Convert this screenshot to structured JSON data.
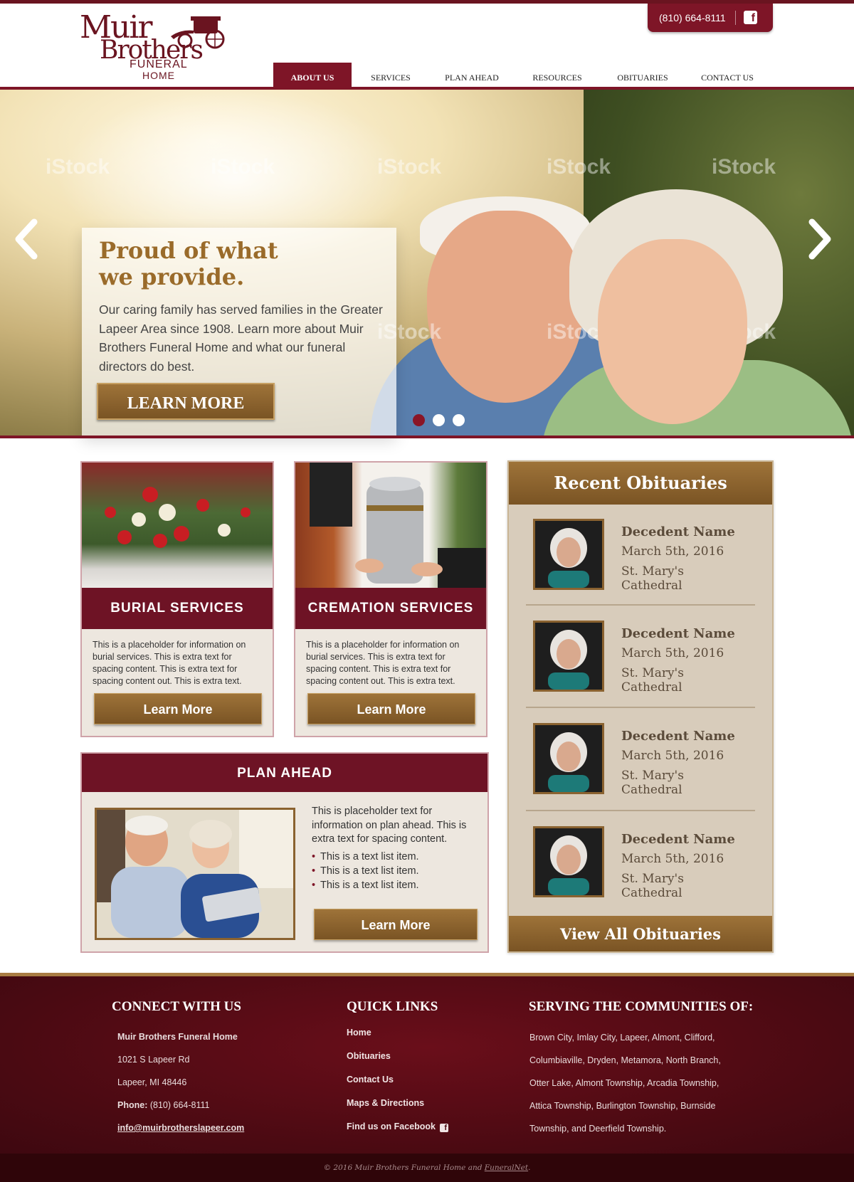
{
  "brand": {
    "logo_line1": "Muir",
    "logo_line2": "Brothers",
    "logo_line3": "FUNERAL",
    "logo_line4": "HOME",
    "color_primary": "#7e1527",
    "color_gold": "#9e7339"
  },
  "header": {
    "phone": "(810) 664-8111",
    "facebook_icon": "f"
  },
  "nav": {
    "items": [
      {
        "label": "ABOUT US",
        "active": true
      },
      {
        "label": "SERVICES"
      },
      {
        "label": "PLAN AHEAD"
      },
      {
        "label": "RESOURCES"
      },
      {
        "label": "OBITUARIES"
      },
      {
        "label": "CONTACT US"
      }
    ]
  },
  "hero": {
    "title_line1": "Proud of what",
    "title_line2": "we provide.",
    "body": "Our caring family has served families in the Greater Lapeer Area since 1908. Learn more about Muir Brothers Funeral Home and what our funeral directors do best.",
    "button": "LEARN MORE",
    "watermark": "iStock",
    "slide_count": 3,
    "active_slide": 1
  },
  "services": [
    {
      "title": "BURIAL SERVICES",
      "text": "This is a placeholder for information on burial services. This is extra text for spacing content. This is extra text for spacing content out. This is extra text.",
      "button": "Learn More"
    },
    {
      "title": "CREMATION SERVICES",
      "text": "This is a placeholder for information on burial services. This is extra text for spacing content. This is extra text for spacing content out. This is extra text.",
      "button": "Learn More"
    }
  ],
  "plan": {
    "title": "PLAN AHEAD",
    "text": "This is placeholder text for information on plan ahead. This is extra text for spacing content.",
    "list": [
      "This is a text list item.",
      "This is a text list item.",
      "This is a text list item."
    ],
    "button": "Learn More"
  },
  "obituaries": {
    "title": "Recent Obituaries",
    "items": [
      {
        "name": "Decedent Name",
        "date": "March 5th, 2016",
        "place": "St. Mary's Cathedral"
      },
      {
        "name": "Decedent Name",
        "date": "March 5th, 2016",
        "place": "St. Mary's Cathedral"
      },
      {
        "name": "Decedent Name",
        "date": "March 5th, 2016",
        "place": "St. Mary's Cathedral"
      },
      {
        "name": "Decedent Name",
        "date": "March 5th, 2016",
        "place": "St. Mary's Cathedral"
      }
    ],
    "button": "View All Obituaries"
  },
  "footer": {
    "connect_title": "CONNECT WITH US",
    "business": "Muir Brothers Funeral Home",
    "address1": "1021 S Lapeer Rd",
    "address2": "Lapeer, MI 48446",
    "phone_label": "Phone:",
    "phone": "(810) 664-8111",
    "email": "info@muirbrotherslapeer.com",
    "links_title": "QUICK LINKS",
    "links": [
      "Home",
      "Obituaries",
      "Contact Us",
      "Maps & Directions",
      "Find us on Facebook"
    ],
    "communities_title": "SERVING THE COMMUNITIES OF:",
    "communities": "Brown City, Imlay City, Lapeer, Almont, Clifford, Columbiaville, Dryden, Metamora, North Branch, Otter Lake, Almont Township, Arcadia Township, Attica Township, Burlington Township, Burnside Township, and Deerfield Township.",
    "copyright_prefix": "© 2016 Muir Brothers Funeral Home and",
    "copyright_link": "FuneralNet",
    "copyright_suffix": "."
  }
}
